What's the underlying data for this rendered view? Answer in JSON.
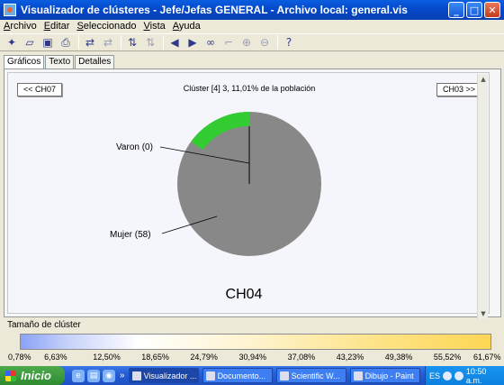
{
  "window": {
    "title": "Visualizador de clústeres - Jefe/Jefas GENERAL - Archivo local: general.vis",
    "minimize": "_",
    "maximize": "□",
    "close": "✕"
  },
  "menu": [
    {
      "key": "A",
      "rest": "rchivo"
    },
    {
      "key": "E",
      "rest": "ditar"
    },
    {
      "key": "S",
      "rest": "eleccionado"
    },
    {
      "key": "V",
      "rest": "ista"
    },
    {
      "key": "A",
      "rest": "yuda"
    }
  ],
  "toolbar_icons": [
    "new-icon",
    "open-icon",
    "save-icon",
    "print-icon",
    "swap-icon",
    "swap-disabled-icon",
    "sort-icon",
    "sort-disabled-icon",
    "left-arrow-icon",
    "right-arrow-icon",
    "binoculars-icon",
    "select-icon",
    "zoom-in-icon",
    "zoom-out-icon",
    "help-icon"
  ],
  "tabs": [
    "Gráficos",
    "Texto",
    "Detalles"
  ],
  "chart": {
    "prev_button": "<< CH07",
    "next_button": "CH03 >>",
    "title": "Clúster [4] 3, 11,01% de la población",
    "cluster_name": "CH04",
    "label_varon": "Varon (0)",
    "label_mujer": "Mujer (58)",
    "colors": {
      "inner": "#888888",
      "outer": "#888888",
      "highlight": "#33cc33"
    }
  },
  "chart_data": {
    "type": "pie",
    "title": "Clúster [4] 3, 11,01% de la población",
    "cluster": "CH04",
    "inner_ring": [
      {
        "label": "Varon",
        "count": 0
      },
      {
        "label": "Mujer",
        "count": 58
      }
    ],
    "outer_ring_highlight_fraction": 0.15
  },
  "legend": {
    "title": "Tamaño de clúster",
    "ticks": [
      "0,78%",
      "6,63%",
      "12,50%",
      "18,65%",
      "24,79%",
      "30,94%",
      "37,08%",
      "43,23%",
      "49,38%",
      "55,52%",
      "61,67%"
    ]
  },
  "taskbar": {
    "start": "Inicio",
    "more": "»",
    "tasks": [
      "Visualizador ...",
      "Documento...",
      "Scientific W...",
      "Dibujo - Paint"
    ],
    "lang": "ES",
    "clock": "10:50 a.m."
  }
}
